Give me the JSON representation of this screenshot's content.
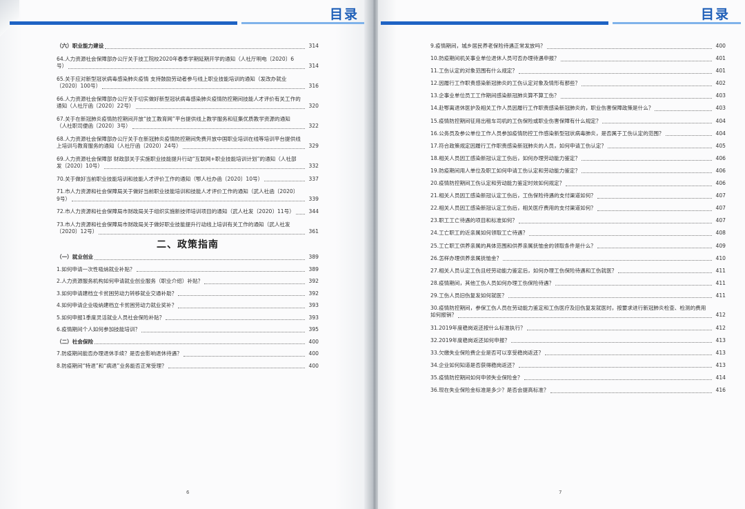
{
  "header": {
    "left_title": "目录",
    "right_title": "目录"
  },
  "left_page": {
    "page_number": "6",
    "top_entries": [
      {
        "text": "（六）职业能力建设",
        "page": "314",
        "bold": true
      },
      {
        "text": "64.人力资源社会保障部办公厅关于技工院校2020年春季学期延期开学的通知（人社厅明电〔2020〕6号）",
        "page": "314"
      },
      {
        "text": "65.关于应对新型冠状病毒感染肺炎疫情 支持鼓励劳动者参与线上职业技能培训的通知（发改办就业〔2020〕100号）",
        "page": "316"
      },
      {
        "text": "66.人力资源社会保障部办公厅关于切实做好新型冠状病毒感染肺炎疫情防控期间技能人才评价有关工作的通知（人社厅函〔2020〕22号）",
        "page": "320"
      },
      {
        "text": "67.关于在新冠肺炎疫情防控期间开放“技工教育网”平台提供线上教学服务和征集优质教学资源的通知（人社职司便函〔2020〕3号）",
        "page": "322"
      },
      {
        "text": "68.人力资源社会保障部办公厅关于在新冠肺炎疫情防控期间免费开放中国职业培训在线等培训平台提供线上培训与教育服务的通知（人社厅函〔2020〕24号）",
        "page": "329"
      },
      {
        "text": "69.人力资源社会保障部 财政部关于实施职业技能提升行动“互联网+职业技能培训计划”的通知（人社部发〔2020〕10号）",
        "page": "332"
      },
      {
        "text": "70.关于做好当前职业技能培训和技能人才评价工作的通知（鄂人社办函〔2020〕10号）",
        "page": "337"
      },
      {
        "text": "71.市人力资源和社会保障局关于做好当前职业技能培训和技能人才评价工作的通知（武人社函〔2020〕9号）",
        "page": "339"
      },
      {
        "text": "72.市人力资源和社会保障局市财政局关于组织实施新技师培训项目的通知（武人社发〔2020〕11号）",
        "page": "344"
      },
      {
        "text": "73.市人力资源和社会保障局市财政局关于做好职业技能提升行动线上培训有关工作的通知（武人社发〔2020〕12号）",
        "page": "361"
      }
    ],
    "section_title": "二、政策指南",
    "bottom_entries": [
      {
        "text": "（一）就业创业",
        "page": "389",
        "bold": true
      },
      {
        "text": "1.如何申请一次性吸纳就业补贴？",
        "page": "389"
      },
      {
        "text": "2.人力资源服务机构如何申请就业创业服务（职业介绍）补贴？",
        "page": "392"
      },
      {
        "text": "3.如何申请建档立卡贫困劳动力转移就业交通补助？",
        "page": "392"
      },
      {
        "text": "4.如何申请企业吸纳建档立卡贫困劳动力就业奖补？",
        "page": "393"
      },
      {
        "text": "5.如何申报1季度灵活就业人员社会保险补贴？",
        "page": "393"
      },
      {
        "text": "6.疫情期间个人如何参加技能培训？",
        "page": "395"
      },
      {
        "text": "（二）社会保险",
        "page": "400",
        "bold": true
      },
      {
        "text": "7.防疫期间能否办理退休手续？是否会影响退休待遇？",
        "page": "400"
      },
      {
        "text": "8.防疫期间“特退”和“病退”业务能否正常受理？",
        "page": "400"
      }
    ]
  },
  "right_page": {
    "page_number": "7",
    "entries": [
      {
        "text": "9.疫情期间，城乡居民养老保险待遇正常发放吗？",
        "page": "400"
      },
      {
        "text": "10.防疫期间机关事业单位退休人员可否办理待遇申报？",
        "page": "401"
      },
      {
        "text": "11.工伤认定的对象范围有什么规定？",
        "page": "401"
      },
      {
        "text": "12.因履行工作职责感染新冠肺炎的工伤认定对象及情形有那些？",
        "page": "402"
      },
      {
        "text": "13.企事业单位员工工作期间感染新冠肺炎算不算工伤？",
        "page": "403"
      },
      {
        "text": "14.赴鄂离退休医护及相关工作人员因履行工作职责感染新冠肺炎的，职业伤害保障政策是什么？",
        "page": "403"
      },
      {
        "text": "15.疫情防控期间征用出租车司机的工伤保险或职业伤害保障有什么规定？",
        "page": "404"
      },
      {
        "text": "16.公务员及参公单位工作人员参加疫情防控工作感染新型冠状病毒肺炎，是否属于工伤认定的范围？",
        "page": "404"
      },
      {
        "text": "17.符合政策规定因履行工作职责感染新冠肺炎的人员，如何申请工伤认定？",
        "page": "405"
      },
      {
        "text": "18.相关人员因工感染新冠认定工伤后，如何办理劳动能力鉴定？",
        "page": "406"
      },
      {
        "text": "19.防疫期间用人单位及职工如何申请工伤认定和劳动能力鉴定？",
        "page": "406"
      },
      {
        "text": "20.疫情防控期间工伤认定和劳动能力鉴定时效如何规定？",
        "page": "406"
      },
      {
        "text": "21.相关人员因工感染新冠认定工伤后，工伤保险待遇的支付渠道如何？",
        "page": "407"
      },
      {
        "text": "22.相关人员因工感染新冠认定工伤后，相关医疗费用的支付渠道如何？",
        "page": "407"
      },
      {
        "text": "23.职工工亡待遇的项目和标准如何？",
        "page": "407"
      },
      {
        "text": "24.工亡职工的近亲属如何领取工亡待遇？",
        "page": "408"
      },
      {
        "text": "25.工亡职工供养亲属的具体范围和供养亲属抚恤金的领取条件是什么？",
        "page": "409"
      },
      {
        "text": "26.怎样办理供养亲属抚恤金？",
        "page": "410"
      },
      {
        "text": "27.相关人员认定工伤且经劳动能力鉴定后，如何办理工伤保险待遇和工伤就医？",
        "page": "411"
      },
      {
        "text": "28.疫情期间，其他工伤人员如何办理工伤保险待遇？",
        "page": "411"
      },
      {
        "text": "29.工伤人员旧伤复发如何就医？",
        "page": "411"
      },
      {
        "text": "30.疫情防控期间，参保工伤人员在劳动能力鉴定和工伤医疗及旧伤复发就医时，按要求进行新冠肺炎检查、检测的费用如何报销？",
        "page": "412"
      },
      {
        "text": "31.2019年度稳岗返还按什么标准执行？",
        "page": "412"
      },
      {
        "text": "32.2019年度稳岗返还如何申报？",
        "page": "413"
      },
      {
        "text": "33.欠缴失业保险费企业是否可以享受稳岗返还？",
        "page": "413"
      },
      {
        "text": "34.企业如何知道是否获得稳岗返还？",
        "page": "413"
      },
      {
        "text": "35.疫情防控期间如何申领失业保险金？",
        "page": "414"
      },
      {
        "text": "36.现在失业保险金标准是多少？是否会提高标准？",
        "page": "416"
      }
    ]
  }
}
